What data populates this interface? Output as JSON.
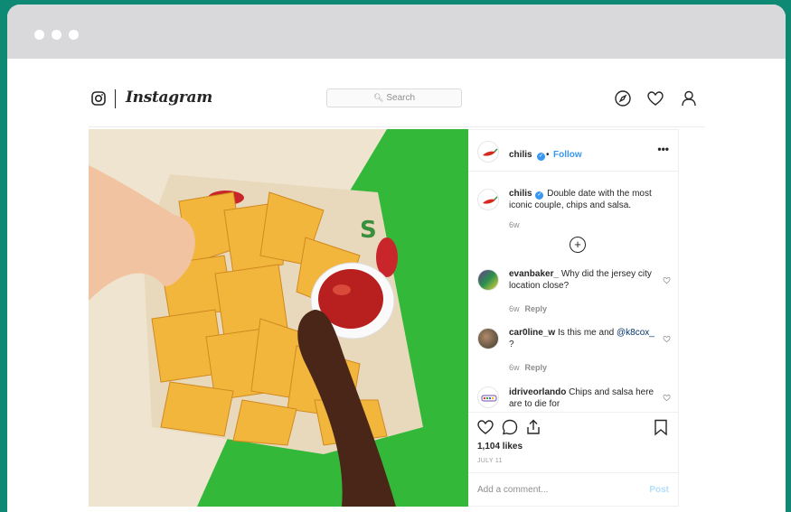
{
  "brand": {
    "wordmark": "Instagram",
    "colors": {
      "accent": "#3897f0",
      "frame": "#0e8a74",
      "titlebar": "#d9d9dc",
      "chips_green": "#34b233"
    }
  },
  "search": {
    "placeholder": "Search",
    "icon": "search-icon"
  },
  "nav_icons": [
    "compass-icon",
    "heart-icon",
    "profile-icon"
  ],
  "post": {
    "username": "chilis",
    "separator": "•",
    "follow_label": "Follow",
    "more_label": "•••",
    "caption": {
      "username": "chilis",
      "text": "Double date with the most iconic couple, chips and salsa.",
      "time": "6w"
    },
    "load_more_label": "+",
    "comments": [
      {
        "username": "evanbaker_",
        "text": "Why did the jersey city location close?",
        "time": "6w",
        "reply": "Reply"
      },
      {
        "username": "car0line_w",
        "text": "Is this me and",
        "mention": "@k8cox_",
        "text_after": " ?",
        "time": "6w",
        "reply": "Reply"
      },
      {
        "username": "idriveorlando",
        "text": "Chips and salsa here are to die for"
      }
    ],
    "likes": "1,104 likes",
    "date": "JULY 11",
    "add_comment_placeholder": "Add a comment...",
    "post_label": "Post"
  }
}
